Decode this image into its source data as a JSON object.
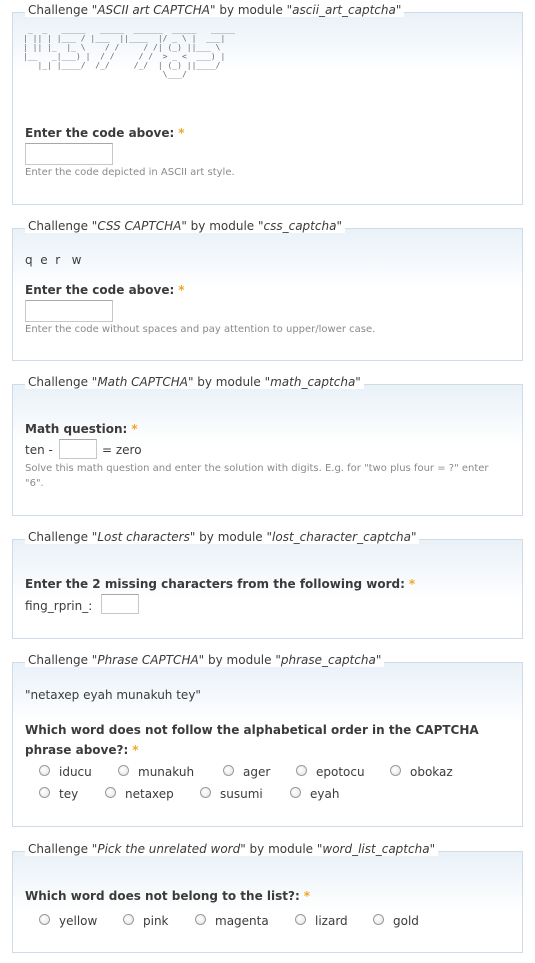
{
  "common": {
    "challenge_prefix": "Challenge \"",
    "by_module": "\" by module \"",
    "suffix": "\"",
    "required_mark": "*"
  },
  "ascii_captcha": {
    "challenge_name": "ASCII art CAPTCHA",
    "module": "ascii_art_captcha",
    "art": " _  _   _____   _____  ______  _____   _____ \n| || | |___ / |___  ||____  |/ _ \\ |  ___|\n| || |_  |_ \\    / /     / /| (_) ||___ \\ \n|__   _|___) |  / /     / /  > _ <  ___) |\n   |_| |____/  /_/     /_/  | (_) ||____/ \n                             \\___/        ",
    "label": "Enter the code above:",
    "input_value": "",
    "description": "Enter the code depicted in ASCII art style."
  },
  "css_captcha": {
    "challenge_name": "CSS CAPTCHA",
    "module": "css_captcha",
    "code": "q  e  r   w",
    "label": "Enter the code above:",
    "input_value": "",
    "description": "Enter the code without spaces and pay attention to upper/lower case."
  },
  "math_captcha": {
    "challenge_name": "Math CAPTCHA",
    "module": "math_captcha",
    "label": "Math question:",
    "prefix": "ten -",
    "suffix": "= zero",
    "input_value": "",
    "description": "Solve this math question and enter the solution with digits. E.g. for \"two plus four = ?\" enter \"6\"."
  },
  "lost_characters": {
    "challenge_name": "Lost characters",
    "module": "lost_character_captcha",
    "label": "Enter the 2 missing characters from the following word:",
    "word": "fing_rprin_:",
    "input_value": ""
  },
  "phrase_captcha": {
    "challenge_name": "Phrase CAPTCHA",
    "module": "phrase_captcha",
    "phrase": "\"netaxep eyah munakuh tey\"",
    "label": "Which word does not follow the alphabetical order in the CAPTCHA phrase above?:",
    "options": [
      "iducu",
      "munakuh",
      "ager",
      "epotocu",
      "obokaz",
      "tey",
      "netaxep",
      "susumi",
      "eyah"
    ]
  },
  "word_list_captcha": {
    "challenge_name": "Pick the unrelated word",
    "module": "word_list_captcha",
    "label": "Which word does not belong to the list?:",
    "options": [
      "yellow",
      "pink",
      "magenta",
      "lizard",
      "gold"
    ]
  },
  "colors": {
    "required": "#f5a623",
    "border": "#cfdbe6",
    "description": "#8a8a8a"
  }
}
